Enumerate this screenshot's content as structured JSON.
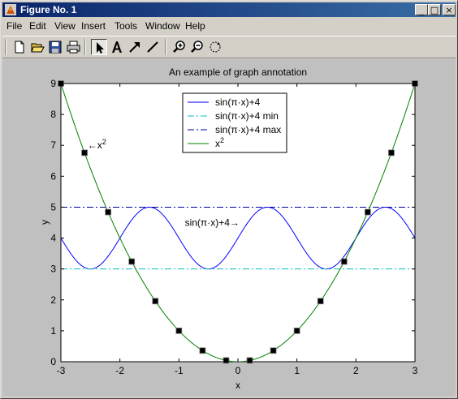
{
  "window": {
    "title": "Figure No. 1",
    "controls": {
      "minimize": "_",
      "maximize": "□",
      "close": "×"
    }
  },
  "menu": [
    "File",
    "Edit",
    "View",
    "Insert",
    "Tools",
    "Window",
    "Help"
  ],
  "toolbar": [
    {
      "name": "new-figure-icon"
    },
    {
      "name": "open-file-icon"
    },
    {
      "name": "save-icon"
    },
    {
      "name": "print-icon"
    },
    {
      "name": "select-arrow-icon",
      "active": true
    },
    {
      "name": "insert-text-icon"
    },
    {
      "name": "insert-arrow-icon"
    },
    {
      "name": "insert-line-icon"
    },
    {
      "name": "zoom-in-icon"
    },
    {
      "name": "zoom-out-icon"
    },
    {
      "name": "rotate-3d-icon"
    }
  ],
  "chart_data": {
    "type": "line",
    "title": "An example of graph annotation",
    "xlabel": "x",
    "ylabel": "y",
    "xlim": [
      -3,
      3
    ],
    "ylim": [
      0,
      9
    ],
    "xticks": [
      -3,
      -2,
      -1,
      0,
      1,
      2,
      3
    ],
    "yticks": [
      0,
      1,
      2,
      3,
      4,
      5,
      6,
      7,
      8,
      9
    ],
    "series": [
      {
        "name": "sin(π·x)+4",
        "color": "#0000ff",
        "style": "solid",
        "function": "sin(pi*x)+4"
      },
      {
        "name": "sin(π·x)+4 min",
        "color": "#00bfbf",
        "style": "dashdot",
        "x": [
          -3,
          3
        ],
        "y": [
          3,
          3
        ]
      },
      {
        "name": "sin(π·x)+4 max",
        "color": "#0000a0",
        "style": "dashdot",
        "x": [
          -3,
          3
        ],
        "y": [
          5,
          5
        ]
      },
      {
        "name": "x²",
        "color": "#008000",
        "style": "solid",
        "function": "x^2",
        "markers_x": [
          -3,
          -2.6,
          -2.2,
          -1.8,
          -1.4,
          -1,
          -0.6,
          -0.2,
          0.2,
          0.6,
          1,
          1.4,
          1.8,
          2.2,
          2.6,
          3
        ]
      }
    ],
    "annotations": [
      {
        "text": "←x",
        "sup": "2",
        "x": -2.55,
        "y": 7
      },
      {
        "text": "sin(π·x)+4→",
        "x": -0.9,
        "y": 4.5
      }
    ],
    "legend_position": "top-center"
  }
}
